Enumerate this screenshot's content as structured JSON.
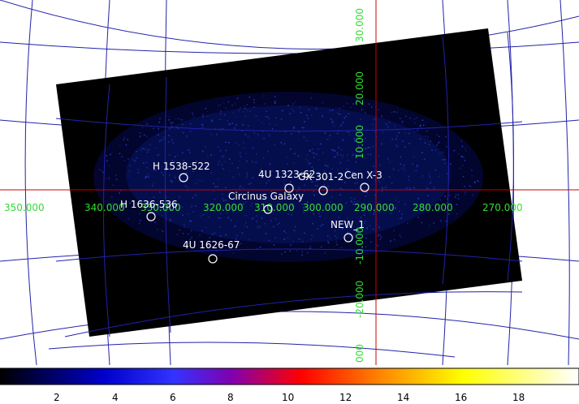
{
  "grid": {
    "longitude_labels": [
      "350.000",
      "340.000",
      "330.000",
      "320.000",
      "310.000",
      "300.000",
      "290.000",
      "280.000",
      "270.000"
    ],
    "latitude_labels": [
      "30.000",
      "20.000",
      "10.000",
      "-10.000",
      "-20.000",
      "000"
    ]
  },
  "sources": [
    {
      "name": "H 1538-522"
    },
    {
      "name": "4U 1323-62"
    },
    {
      "name": "GX 301-2"
    },
    {
      "name": "Cen X-3"
    },
    {
      "name": "Circinus Galaxy"
    },
    {
      "name": "H 1636-536"
    },
    {
      "name": "NEW_1"
    },
    {
      "name": "4U 1626-67"
    }
  ],
  "colorbar": {
    "ticks": [
      "2",
      "4",
      "6",
      "8",
      "10",
      "12",
      "14",
      "16",
      "18"
    ],
    "colors": [
      "#000000",
      "#0000ff",
      "#7a00b0",
      "#ff0000",
      "#ffaa00",
      "#ffff44",
      "#ffffff"
    ]
  },
  "colors": {
    "grid_lines": "#2222aa",
    "crosshair": "#cc0000",
    "grid_text": "#33dd33",
    "source_marker": "#ffffff",
    "image_bg": "#000000"
  }
}
